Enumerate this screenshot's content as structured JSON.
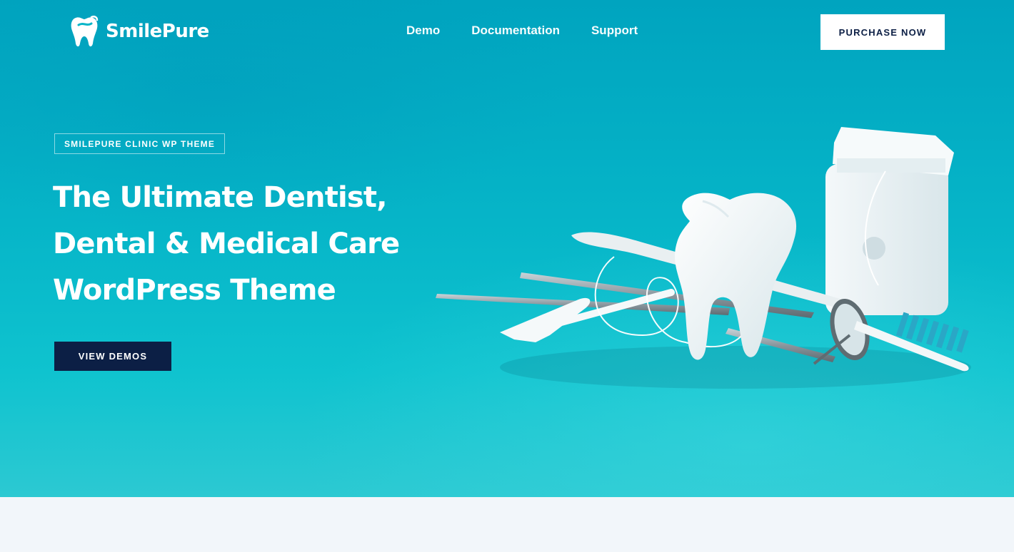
{
  "brand": {
    "name": "SmilePure"
  },
  "nav": {
    "items": [
      "Demo",
      "Documentation",
      "Support"
    ]
  },
  "header": {
    "cta_label": "PURCHASE NOW"
  },
  "hero": {
    "tag": "SMILEPURE CLINIC WP THEME",
    "headline_lines": [
      "The Ultimate Dentist,",
      "Dental & Medical Care",
      "WordPress Theme"
    ],
    "cta_label": "VIEW DEMOS",
    "image_icon": "dental-tools-illustration"
  },
  "colors": {
    "hero_bg": "#06b5c8",
    "dark_navy": "#0c1f45",
    "white": "#ffffff",
    "page_bg": "#f2f6fa"
  }
}
